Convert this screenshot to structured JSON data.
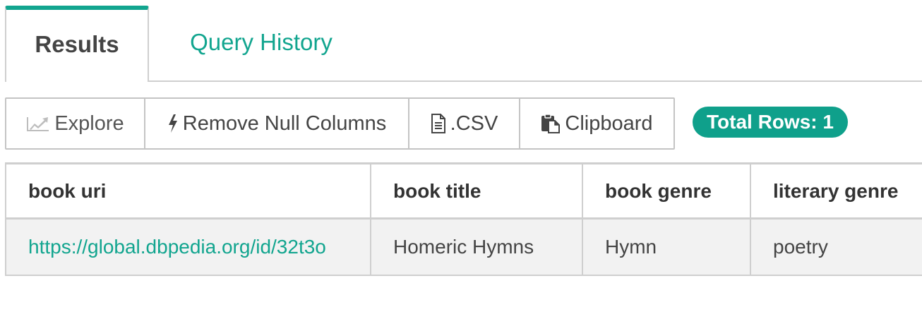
{
  "tabs": {
    "results_label": "Results",
    "history_label": "Query History"
  },
  "toolbar": {
    "explore_label": "Explore",
    "explore_icon": "line-chart-icon",
    "remove_null_label": "Remove Null Columns",
    "remove_null_icon": "lightning-bolt-icon",
    "csv_label": ".CSV",
    "csv_icon": "document-icon",
    "clipboard_label": "Clipboard",
    "clipboard_icon": "clipboard-icon"
  },
  "total_rows": {
    "label": "Total Rows: 1"
  },
  "table": {
    "headers": [
      "book uri",
      "book title",
      "book genre",
      "literary genre"
    ],
    "rows": [
      [
        "https://global.dbpedia.org/id/32t3o",
        "Homeric Hymns",
        "Hymn",
        "poetry"
      ]
    ]
  },
  "colors": {
    "accent": "#12a58f",
    "badge_bg": "#0fa08b",
    "row_bg": "#f2f2f2",
    "border": "#cfcfcf"
  }
}
